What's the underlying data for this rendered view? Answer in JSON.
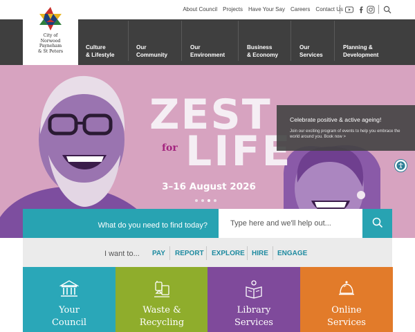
{
  "logo": {
    "lines": [
      "City of",
      "Norwood",
      "Payneham",
      "& St Peters"
    ]
  },
  "utility": {
    "links": [
      "About Council",
      "Projects",
      "Have Your Say",
      "Careers",
      "Contact Us"
    ],
    "icons": [
      "youtube-icon",
      "facebook-icon",
      "instagram-icon",
      "search-icon"
    ]
  },
  "nav": {
    "items": [
      {
        "line1": "Culture",
        "line2": "& Lifestyle"
      },
      {
        "line1": "Our",
        "line2": "Community"
      },
      {
        "line1": "Our",
        "line2": "Environment"
      },
      {
        "line1": "Business",
        "line2": "& Economy"
      },
      {
        "line1": "Our",
        "line2": "Services"
      },
      {
        "line1": "Planning &",
        "line2": "Development"
      }
    ]
  },
  "hero": {
    "title_top": "ZEST",
    "title_for": "for",
    "title_bottom": "LIFE",
    "dates": "3–16 August 2026",
    "callout_title": "Celebrate positive & active ageing!",
    "callout_body": "Join our exciting program of events to help you embrace the world around you. Book now >",
    "slide_count": 4,
    "active_slide": 3
  },
  "search": {
    "label": "What do you need to find today?",
    "placeholder": "Type here and we'll help out..."
  },
  "want": {
    "label": "I want to...",
    "links": [
      "PAY",
      "REPORT",
      "EXPLORE",
      "HIRE",
      "ENGAGE"
    ]
  },
  "tiles": [
    {
      "line1": "Your",
      "line2": "Council",
      "color": "#2aa7b8",
      "icon": "building-icon"
    },
    {
      "line1": "Waste &",
      "line2": "Recycling",
      "color": "#8fad2c",
      "icon": "recycling-icon"
    },
    {
      "line1": "Library",
      "line2": "Services",
      "color": "#7f4a9b",
      "icon": "library-icon"
    },
    {
      "line1": "Online",
      "line2": "Services",
      "color": "#e27b2a",
      "icon": "bell-icon"
    }
  ],
  "colors": {
    "nav_bg": "#3f3f3f",
    "hero_bg": "#d7a3c0",
    "teal": "#28a3b2",
    "link_blue": "#1e8aa0"
  }
}
